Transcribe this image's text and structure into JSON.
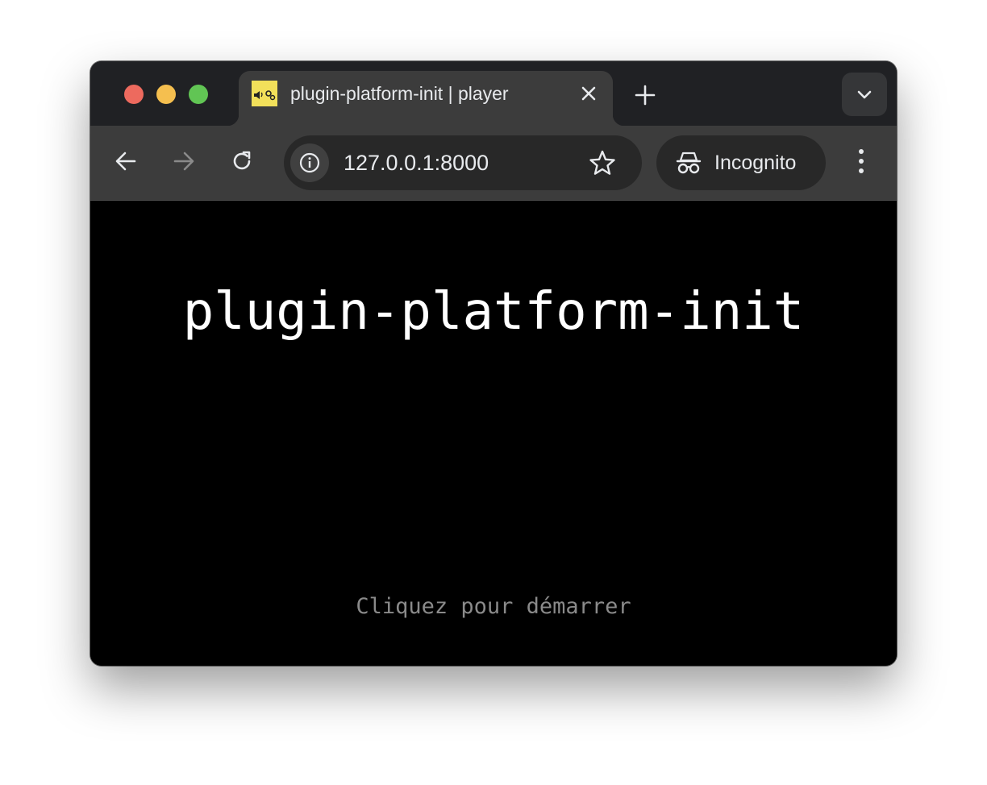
{
  "browser": {
    "tab": {
      "title": "plugin-platform-init | player",
      "favicon": "speaker-and-gears-favicon",
      "favicon_color": "#f2e05a"
    },
    "address_bar": {
      "url": "127.0.0.1:8000"
    },
    "profile": {
      "label": "Incognito"
    },
    "colors": {
      "tabstrip": "#202124",
      "toolbar": "#3c3c3c",
      "omnibox": "#282828",
      "traffic_close": "#ed6a5e",
      "traffic_minimize": "#f5bf4f",
      "traffic_maximize": "#61c554"
    },
    "icons": [
      "back-arrow-icon",
      "forward-arrow-icon",
      "reload-icon",
      "site-info-icon",
      "bookmark-star-icon",
      "incognito-icon",
      "kebab-menu-icon",
      "new-tab-plus-icon",
      "tab-close-icon",
      "tab-search-chevron-icon"
    ]
  },
  "page": {
    "background": "#000000",
    "title": "plugin-platform-init",
    "start_hint": "Cliquez pour démarrer",
    "title_color": "#ffffff",
    "hint_color": "#8a8a8a"
  }
}
